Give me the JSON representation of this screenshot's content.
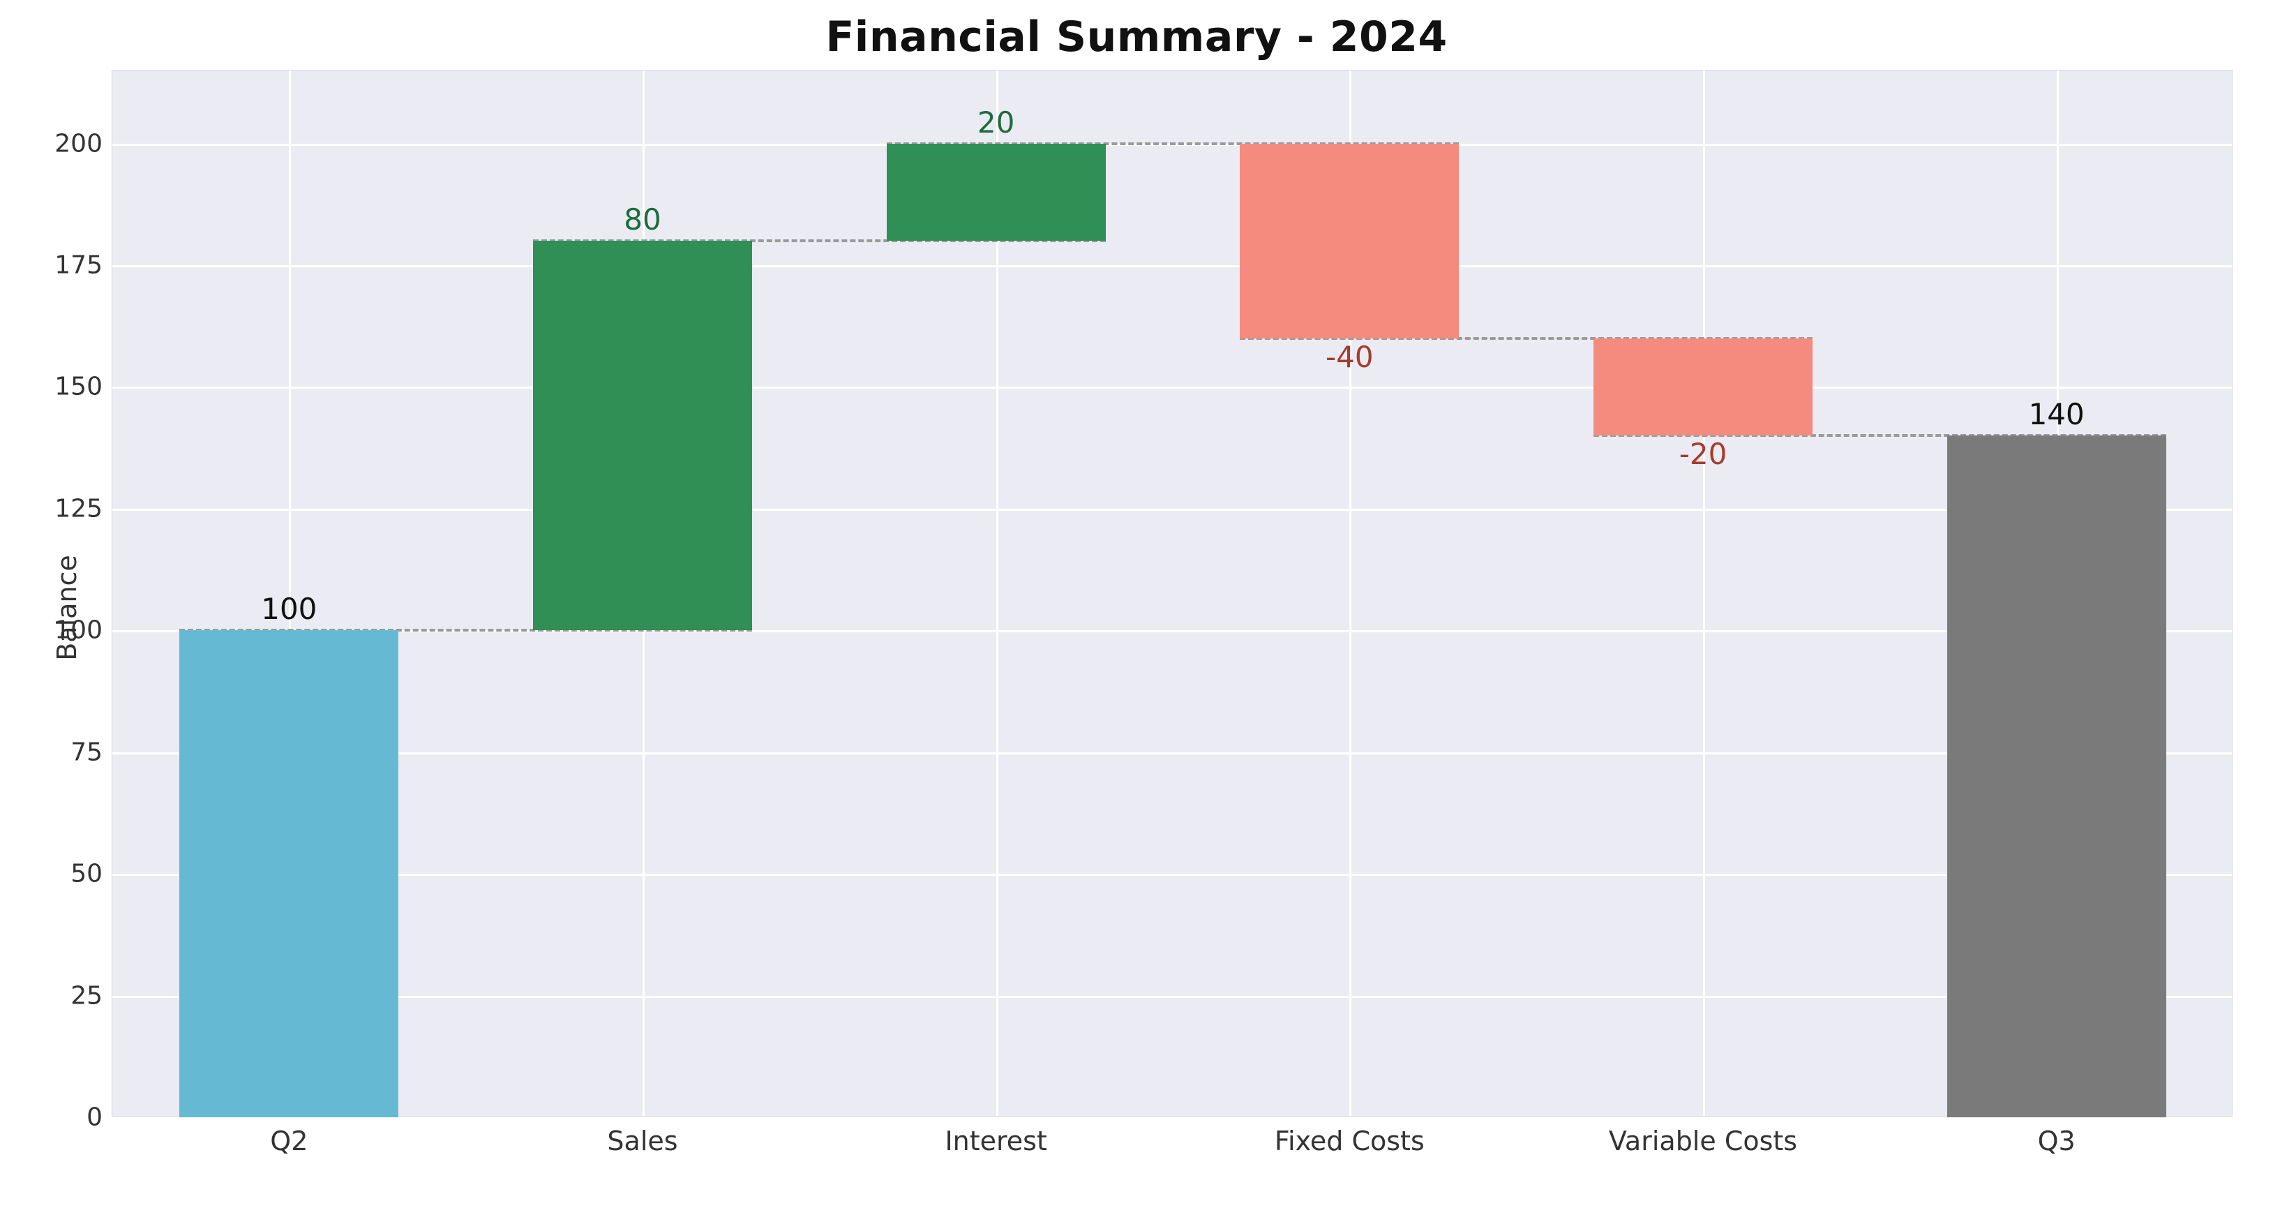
{
  "chart_data": {
    "type": "waterfall",
    "title": "Financial Summary - 2024",
    "ylabel": "Balance",
    "xlabel": "",
    "ylim": [
      0,
      215
    ],
    "yticks": [
      0,
      25,
      50,
      75,
      100,
      125,
      150,
      175,
      200
    ],
    "categories": [
      "Q2",
      "Sales",
      "Interest",
      "Fixed Costs",
      "Variable Costs",
      "Q3"
    ],
    "bars": [
      {
        "label": "Q2",
        "kind": "total",
        "bottom": 0,
        "top": 100,
        "delta": 100,
        "data_label": "100"
      },
      {
        "label": "Sales",
        "kind": "increase",
        "bottom": 100,
        "top": 180,
        "delta": 80,
        "data_label": "80"
      },
      {
        "label": "Interest",
        "kind": "increase",
        "bottom": 180,
        "top": 200,
        "delta": 20,
        "data_label": "20"
      },
      {
        "label": "Fixed Costs",
        "kind": "decrease",
        "bottom": 160,
        "top": 200,
        "delta": -40,
        "data_label": "-40"
      },
      {
        "label": "Variable Costs",
        "kind": "decrease",
        "bottom": 140,
        "top": 160,
        "delta": -20,
        "data_label": "-20"
      },
      {
        "label": "Q3",
        "kind": "total",
        "bottom": 0,
        "top": 140,
        "delta": 140,
        "data_label": "140"
      }
    ],
    "colors": {
      "total_first": "#66b9d3",
      "total_last": "#7a7a7a",
      "increase": "#2f8f55",
      "decrease": "#f48b7e",
      "label_increase": "#1f6b3c",
      "label_decrease": "#a83a2d",
      "label_total": "#111111"
    }
  }
}
